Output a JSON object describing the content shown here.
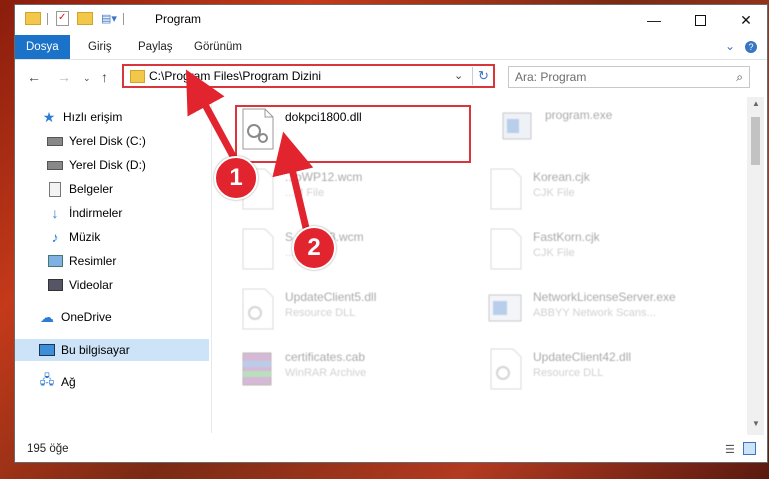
{
  "window": {
    "title": "Program"
  },
  "ribbon": {
    "tabs": [
      "Dosya",
      "Giriş",
      "Paylaş",
      "Görünüm"
    ]
  },
  "address": {
    "path": "C:\\Program Files\\Program Dizini",
    "search_placeholder": "Ara: Program"
  },
  "sidebar": {
    "items": [
      {
        "label": "Hızlı erişim"
      },
      {
        "label": "Yerel Disk (C:)"
      },
      {
        "label": "Yerel Disk (D:)"
      },
      {
        "label": "Belgeler"
      },
      {
        "label": "İndirmeler"
      },
      {
        "label": "Müzik"
      },
      {
        "label": "Resimler"
      },
      {
        "label": "Videolar"
      },
      {
        "label": "OneDrive"
      },
      {
        "label": "Bu bilgisayar"
      },
      {
        "label": "Ağ"
      }
    ]
  },
  "files": {
    "highlighted": {
      "name": "dokpci1800.dll"
    },
    "others": [
      {
        "name": "program.exe",
        "desc": ""
      },
      {
        "name": "...oWP12.wcm",
        "desc": "...M File"
      },
      {
        "name": "Korean.cjk",
        "desc": "CJK File"
      },
      {
        "name": "S...WP13.wcm",
        "desc": "...File"
      },
      {
        "name": "FastKorn.cjk",
        "desc": "CJK File"
      },
      {
        "name": "UpdateClient5.dll",
        "desc": "Resource DLL"
      },
      {
        "name": "NetworkLicenseServer.exe",
        "desc": "ABBYY Network Scans..."
      },
      {
        "name": "certificates.cab",
        "desc": "WinRAR Archive"
      },
      {
        "name": "UpdateClient42.dll",
        "desc": "Resource DLL"
      }
    ]
  },
  "status": {
    "count": "195 öğe"
  },
  "annotations": {
    "step1": "1",
    "step2": "2"
  },
  "colors": {
    "accent": "#1a73c8",
    "highlight": "#d9353a",
    "badge": "#e1242e"
  }
}
